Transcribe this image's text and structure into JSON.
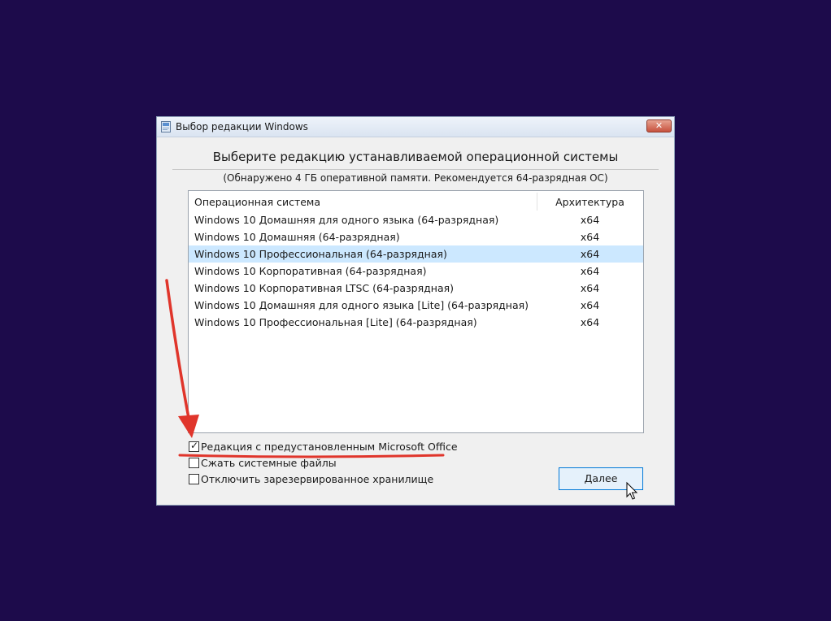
{
  "window": {
    "title": "Выбор редакции Windows",
    "close_glyph": "✕"
  },
  "heading": "Выберите редакцию устанавливаемой операционной системы",
  "subheading": "(Обнаружено 4 ГБ оперативной памяти. Рекомендуется 64-разрядная ОС)",
  "list": {
    "columns": {
      "os": "Операционная система",
      "arch": "Архитектура"
    },
    "rows": [
      {
        "name": "Windows 10 Домашняя для одного языка (64-разрядная)",
        "arch": "x64",
        "selected": false
      },
      {
        "name": "Windows 10 Домашняя (64-разрядная)",
        "arch": "x64",
        "selected": false
      },
      {
        "name": "Windows 10 Профессиональная (64-разрядная)",
        "arch": "x64",
        "selected": true
      },
      {
        "name": "Windows 10 Корпоративная (64-разрядная)",
        "arch": "x64",
        "selected": false
      },
      {
        "name": "Windows 10 Корпоративная LTSC (64-разрядная)",
        "arch": "x64",
        "selected": false
      },
      {
        "name": "Windows 10 Домашняя для одного языка [Lite] (64-разрядная)",
        "arch": "x64",
        "selected": false
      },
      {
        "name": "Windows 10 Профессиональная [Lite] (64-разрядная)",
        "arch": "x64",
        "selected": false
      }
    ]
  },
  "options": [
    {
      "label": "Редакция с предустановленным Microsoft Office",
      "checked": true
    },
    {
      "label": "Сжать системные файлы",
      "checked": false
    },
    {
      "label": "Отключить зарезервированное хранилище",
      "checked": false
    }
  ],
  "check_glyph": "✓",
  "next_button": "Далее",
  "colors": {
    "desktop": "#1d0b4b",
    "selection": "#cce8ff",
    "button_border": "#0078d7",
    "annotation": "#e0352b"
  },
  "icons": {
    "window_icon": "setup-icon",
    "close": "close-icon",
    "cursor": "mouse-pointer-icon"
  }
}
